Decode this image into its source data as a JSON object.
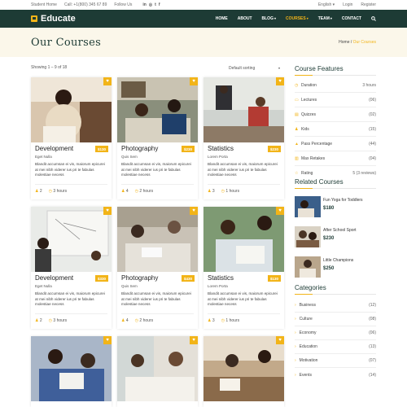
{
  "topbar": {
    "home": "Student Home",
    "call": "Call: +1(800) 345 67 89",
    "follow": "Follow Us",
    "social": [
      "in",
      "◎",
      "t",
      "f"
    ],
    "language": "English",
    "login": "Login",
    "register": "Register"
  },
  "header": {
    "logo": "Educate",
    "nav": [
      {
        "label": "HOME",
        "caret": ""
      },
      {
        "label": "ABOUT",
        "caret": ""
      },
      {
        "label": "BLOG",
        "caret": "▾"
      },
      {
        "label": "COURSES",
        "caret": "▾"
      },
      {
        "label": "TEAM",
        "caret": "▾"
      },
      {
        "label": "CONTACT",
        "caret": ""
      }
    ]
  },
  "page": {
    "title": "Our Courses",
    "breadcrumb_home": "Home",
    "breadcrumb_sep": "/",
    "breadcrumb_current": "Our Courses"
  },
  "toolbar": {
    "showing": "Showing 1 – 9 of 18",
    "sorting": "Default sorting"
  },
  "courses": [
    {
      "title": "Development",
      "author": "Eget Nulla",
      "price": "$130",
      "desc": "Blandit accumsan ei vis, maiorum epicurei at mei nibh viderer ius pri te fabulas molestiae necess",
      "students": "2",
      "duration": "3 hours"
    },
    {
      "title": "Photography",
      "author": "Quis Sem",
      "price": "$230",
      "desc": "Blandit accumsan ei vis, maiorum epicurei at mei nibh viderer ius pri te fabulas molestiae necess",
      "students": "4",
      "duration": "2 hours"
    },
    {
      "title": "Statistics",
      "author": "Lorem Porta",
      "price": "$230",
      "desc": "Blandit accumsan ei vis, maiorum epicurei at mei nibh viderer ius pri te fabulas molestiae necess",
      "students": "3",
      "duration": "1 hours"
    },
    {
      "title": "Development",
      "author": "Eget Nulla",
      "price": "$330",
      "desc": "Blandit accumsan ei vis, maiorum epicurei at mei nibh viderer ius pri te fabulas molestiae necess",
      "students": "2",
      "duration": "3 hours"
    },
    {
      "title": "Photography",
      "author": "Quis Sem",
      "price": "$430",
      "desc": "Blandit accumsan ei vis, maiorum epicurei at mei nibh viderer ius pri te fabulas molestiae necess",
      "students": "4",
      "duration": "2 hours"
    },
    {
      "title": "Statistics",
      "author": "Lorem Porta",
      "price": "$130",
      "desc": "Blandit accumsan ei vis, maiorum epicurei at mei nibh viderer ius pri te fabulas molestiae necess",
      "students": "3",
      "duration": "1 hours"
    },
    {
      "title": "",
      "author": "",
      "price": "",
      "desc": "",
      "students": "",
      "duration": ""
    },
    {
      "title": "",
      "author": "",
      "price": "",
      "desc": "",
      "students": "",
      "duration": ""
    },
    {
      "title": "",
      "author": "",
      "price": "",
      "desc": "",
      "students": "",
      "duration": ""
    }
  ],
  "features": {
    "heading": "Course Features",
    "items": [
      {
        "label": "Duration",
        "value": "3 hours",
        "icon": "clock-icon"
      },
      {
        "label": "Lectures",
        "value": "(06)",
        "icon": "book-icon"
      },
      {
        "label": "Quizzes",
        "value": "(02)",
        "icon": "quiz-icon"
      },
      {
        "label": "Kids",
        "value": "(15)",
        "icon": "kids-icon"
      },
      {
        "label": "Pass Percentage",
        "value": "(44)",
        "icon": "percent-icon"
      },
      {
        "label": "Max Retakes",
        "value": "(04)",
        "icon": "retake-icon"
      },
      {
        "label": "Rating",
        "value": "5 (3 reviews)",
        "icon": "star-icon"
      }
    ]
  },
  "related": {
    "heading": "Related Courses",
    "items": [
      {
        "title": "Fun Yoga for Toddlers",
        "price": "$180"
      },
      {
        "title": "After School Sport",
        "price": "$230"
      },
      {
        "title": "Little Champions",
        "price": "$250"
      }
    ]
  },
  "categories": {
    "heading": "Categories",
    "items": [
      {
        "label": "Business",
        "count": "(12)"
      },
      {
        "label": "Culture",
        "count": "(08)"
      },
      {
        "label": "Economy",
        "count": "(06)"
      },
      {
        "label": "Education",
        "count": "(13)"
      },
      {
        "label": "Motivation",
        "count": "(07)"
      },
      {
        "label": "Events",
        "count": "(14)"
      }
    ]
  },
  "colors": {
    "accent": "#f2b418",
    "dark": "#1d3b35",
    "cream": "#fbf7ea"
  }
}
